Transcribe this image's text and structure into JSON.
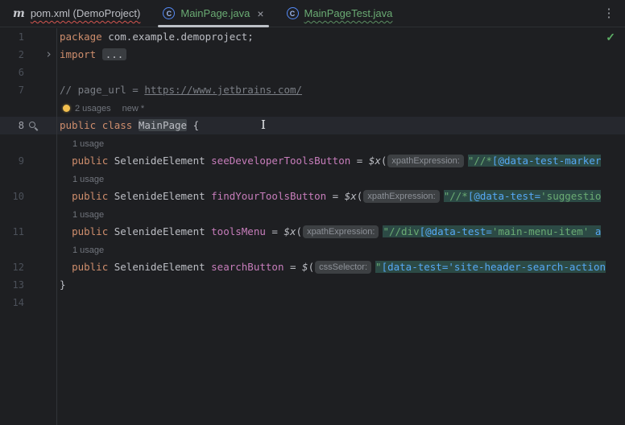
{
  "tabs": {
    "items": [
      {
        "label": "pom.xml (DemoProject)"
      },
      {
        "label": "MainPage.java",
        "close": "×"
      },
      {
        "label": "MainPageTest.java"
      }
    ]
  },
  "icons": {
    "maven": "m",
    "class_letter": "C",
    "kebab": "⋮",
    "check": "✓",
    "chevron": "›",
    "ibeam": "I"
  },
  "editor": {
    "rows": [
      {
        "t": "code",
        "n": "1",
        "segs": [
          [
            "kw",
            "package"
          ],
          [
            "pl",
            " com.example.demoproject;"
          ]
        ]
      },
      {
        "t": "code",
        "n": "2",
        "g": "fold",
        "segs": [
          [
            "kw",
            "import"
          ],
          [
            "pl",
            " "
          ],
          [
            "fold",
            "..."
          ]
        ]
      },
      {
        "t": "code",
        "n": "6",
        "segs": []
      },
      {
        "t": "code",
        "n": "7",
        "segs": [
          [
            "cm",
            "// page_url = "
          ],
          [
            "cmlink",
            "https://www.jetbrains.com/"
          ]
        ]
      },
      {
        "t": "inlay",
        "pad": 6,
        "segs": [
          [
            "bulb",
            ""
          ],
          [
            "usage",
            "2 usages"
          ],
          [
            "usage",
            "new *"
          ]
        ]
      },
      {
        "t": "code",
        "n": "8",
        "g": "zoom",
        "caret": true,
        "segs": [
          [
            "kw",
            "public"
          ],
          [
            "pl",
            " "
          ],
          [
            "kw",
            "class"
          ],
          [
            "pl",
            " "
          ],
          [
            "hl",
            "MainPage"
          ],
          [
            "pl",
            " {"
          ]
        ]
      },
      {
        "t": "inlay",
        "pad": 20,
        "segs": [
          [
            "usage",
            "1 usage"
          ]
        ]
      },
      {
        "t": "code",
        "n": "9",
        "segs": [
          [
            "pl",
            "  "
          ],
          [
            "kw",
            "public"
          ],
          [
            "pl",
            " SelenideElement "
          ],
          [
            "fld",
            "seeDeveloperToolsButton"
          ],
          [
            "pl",
            " = "
          ],
          [
            "dollar",
            "$x"
          ],
          [
            "pl",
            "("
          ],
          [
            "chip",
            "xpathExpression:"
          ],
          [
            "inj-g",
            "\"//*"
          ],
          [
            "inj-b",
            "[@data-test-marker"
          ]
        ]
      },
      {
        "t": "inlay",
        "pad": 20,
        "segs": [
          [
            "usage",
            "1 usage"
          ]
        ]
      },
      {
        "t": "code",
        "n": "10",
        "segs": [
          [
            "pl",
            "  "
          ],
          [
            "kw",
            "public"
          ],
          [
            "pl",
            " SelenideElement "
          ],
          [
            "fld",
            "findYourToolsButton"
          ],
          [
            "pl",
            " = "
          ],
          [
            "dollar",
            "$x"
          ],
          [
            "pl",
            "("
          ],
          [
            "chip",
            "xpathExpression:"
          ],
          [
            "inj-g",
            "\"//*"
          ],
          [
            "inj-b",
            "[@data-test="
          ],
          [
            "inj-g",
            "'suggestio"
          ]
        ]
      },
      {
        "t": "inlay",
        "pad": 20,
        "segs": [
          [
            "usage",
            "1 usage"
          ]
        ]
      },
      {
        "t": "code",
        "n": "11",
        "segs": [
          [
            "pl",
            "  "
          ],
          [
            "kw",
            "public"
          ],
          [
            "pl",
            " SelenideElement "
          ],
          [
            "fld",
            "toolsMenu"
          ],
          [
            "pl",
            " = "
          ],
          [
            "dollar",
            "$x"
          ],
          [
            "pl",
            "("
          ],
          [
            "chip",
            "xpathExpression:"
          ],
          [
            "inj-g",
            "\"//div"
          ],
          [
            "inj-b",
            "[@data-test="
          ],
          [
            "inj-g",
            "'main-menu-item'"
          ],
          [
            "inj-b",
            " a"
          ]
        ]
      },
      {
        "t": "inlay",
        "pad": 20,
        "segs": [
          [
            "usage",
            "1 usage"
          ]
        ]
      },
      {
        "t": "code",
        "n": "12",
        "segs": [
          [
            "pl",
            "  "
          ],
          [
            "kw",
            "public"
          ],
          [
            "pl",
            " SelenideElement "
          ],
          [
            "fld",
            "searchButton"
          ],
          [
            "pl",
            " = "
          ],
          [
            "dollar",
            "$"
          ],
          [
            "pl",
            "("
          ],
          [
            "chip",
            "cssSelector:"
          ],
          [
            "inj-g",
            "\""
          ],
          [
            "inj-b",
            "[data-test='site-header-search-action"
          ]
        ]
      },
      {
        "t": "code",
        "n": "13",
        "segs": [
          [
            "pl",
            "}"
          ]
        ]
      },
      {
        "t": "code",
        "n": "14",
        "segs": []
      }
    ]
  }
}
